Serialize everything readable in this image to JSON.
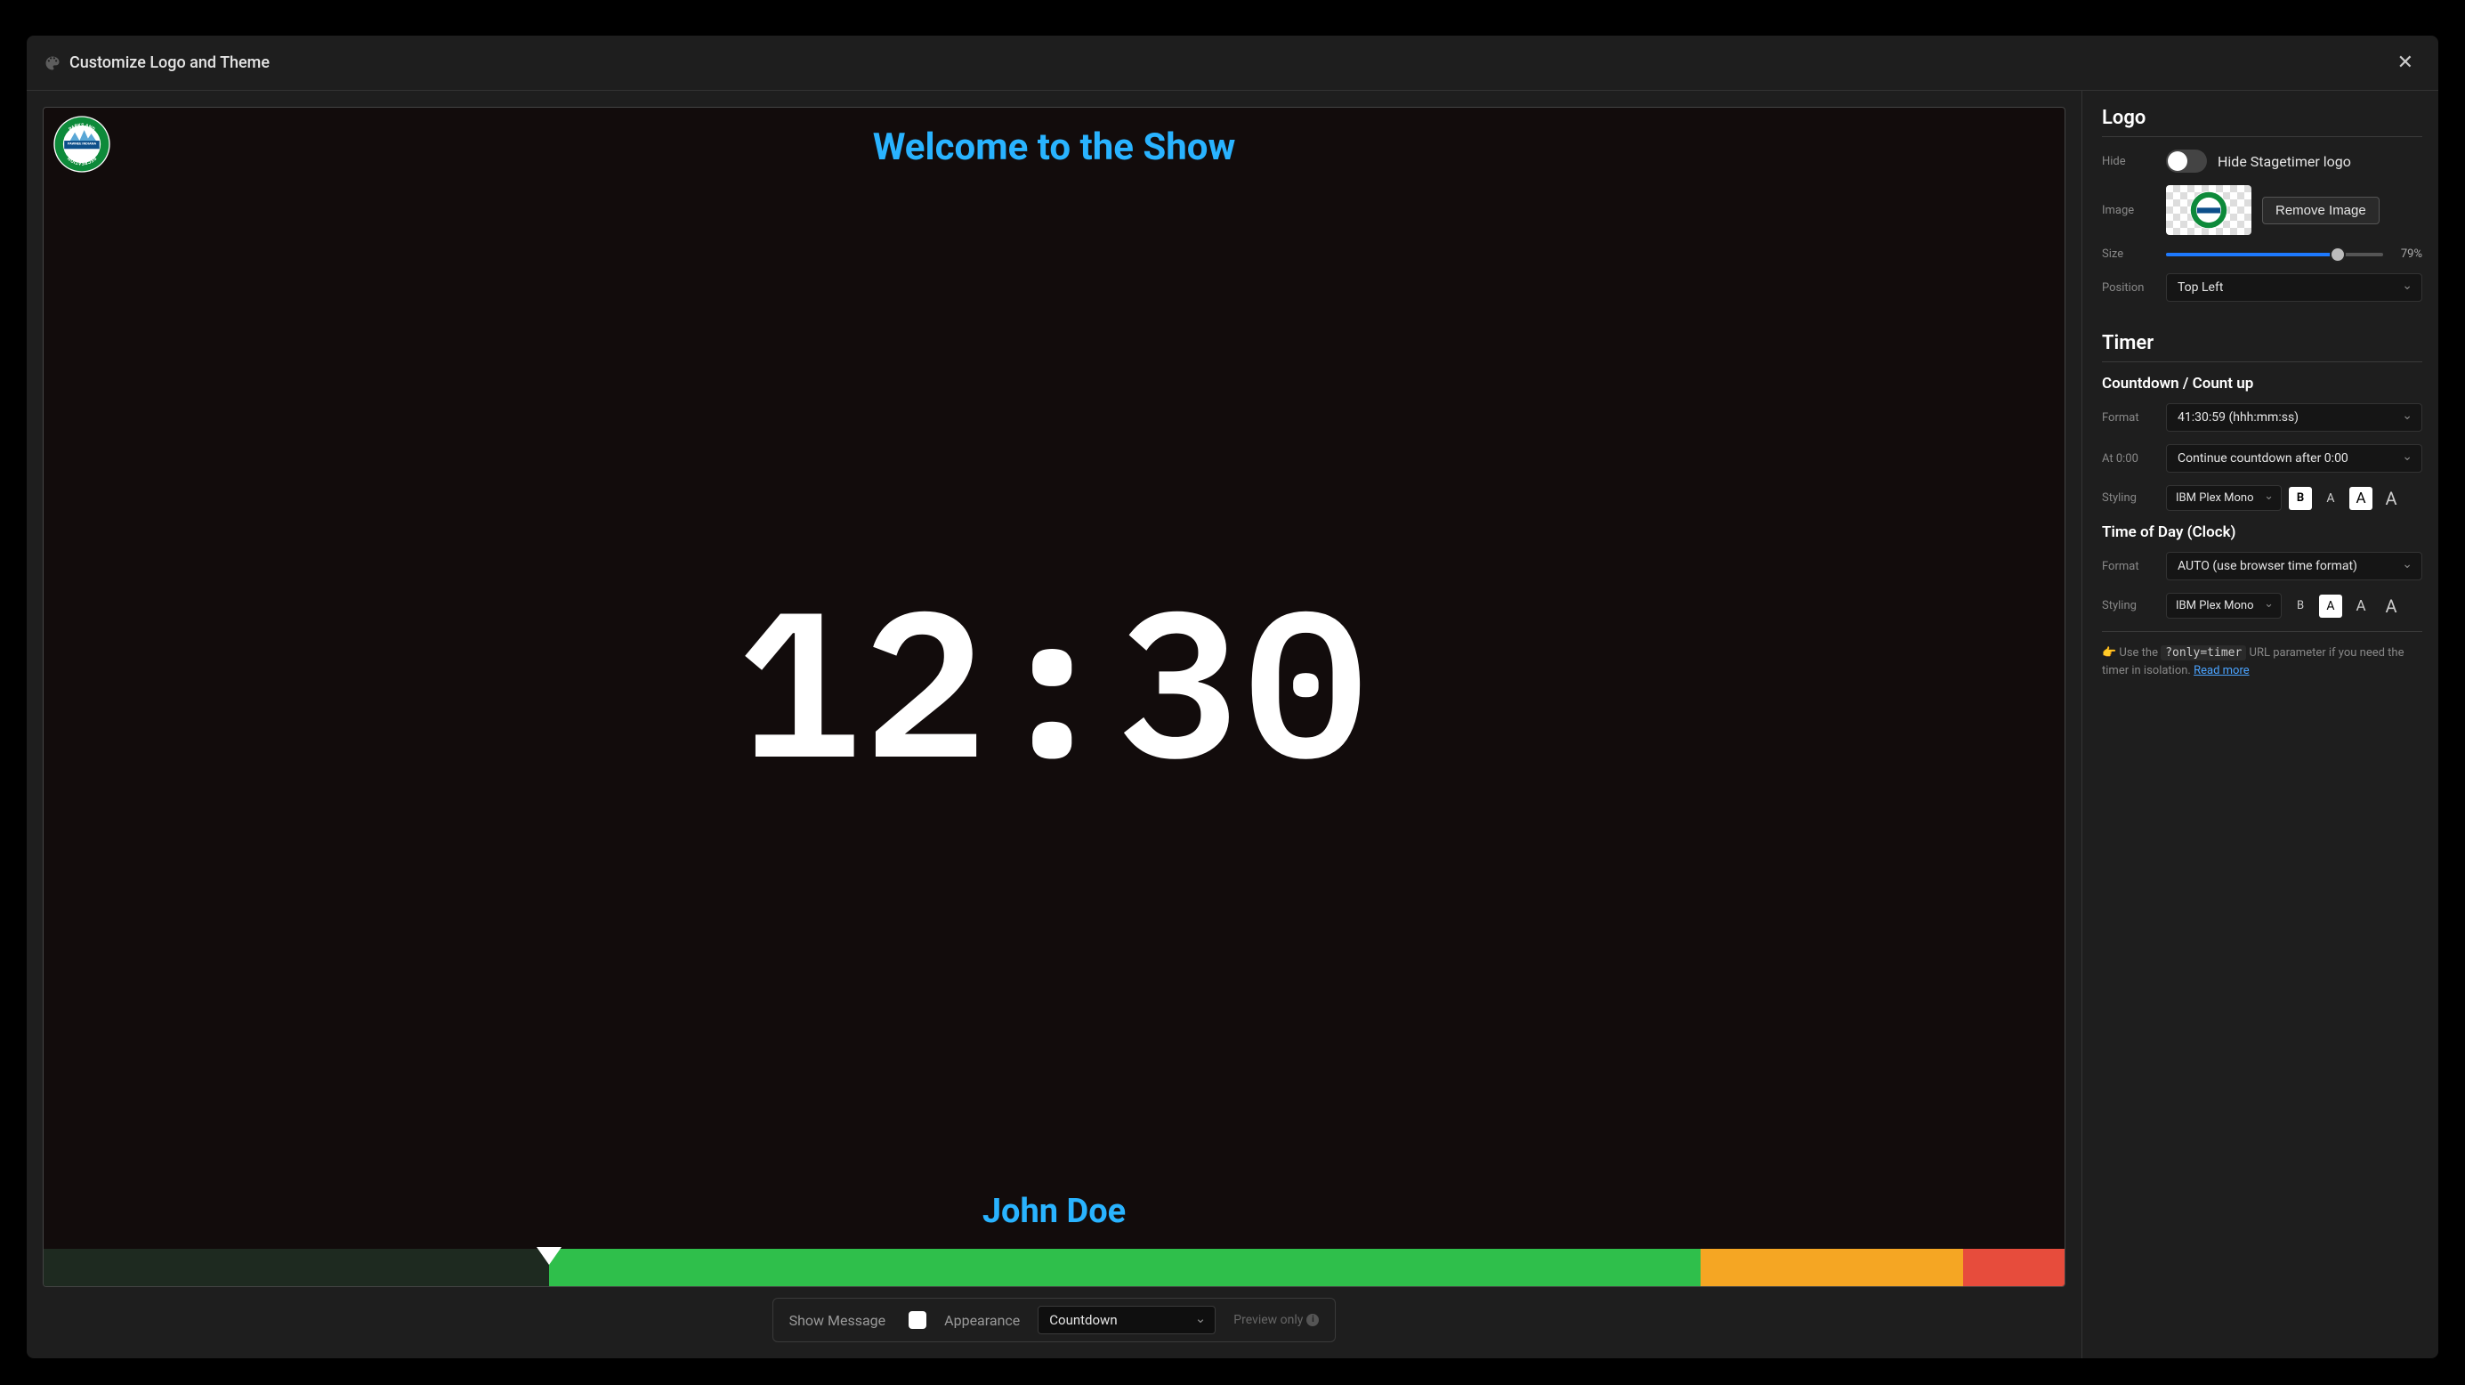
{
  "modal": {
    "title": "Customize Logo and Theme",
    "close_glyph": "✕"
  },
  "preview": {
    "title": "Welcome to the Show",
    "timer_display": "12:30",
    "speaker": "John Doe",
    "progress": {
      "empty_pct": 25,
      "green_pct": 57,
      "orange_pct": 13,
      "red_pct": 5,
      "marker_pct": 25
    },
    "controls": {
      "show_message_label": "Show Message",
      "show_message_checked": false,
      "appearance_label": "Appearance",
      "appearance_value": "Countdown",
      "preview_only_label": "Preview only"
    },
    "logo_badge": {
      "top": "PARKS AND",
      "mid": "PAWNEE INDIANA",
      "bot": "RECREATION"
    }
  },
  "sidebar": {
    "logo": {
      "heading": "Logo",
      "hide_label": "Hide",
      "hide_toggle_text": "Hide Stagetimer logo",
      "hide_toggle_on": false,
      "image_label": "Image",
      "remove_image_btn": "Remove Image",
      "size_label": "Size",
      "size_pct": 79,
      "size_pct_text": "79%",
      "position_label": "Position",
      "position_value": "Top Left"
    },
    "timer": {
      "heading": "Timer",
      "countdown_heading": "Countdown / Count up",
      "format_label": "Format",
      "format_value": "41:30:59 (hhh:mm:ss)",
      "at_zero_label": "At 0:00",
      "at_zero_value": "Continue countdown after 0:00",
      "styling_label": "Styling",
      "font_value": "IBM Plex Mono",
      "bold_btn": "B",
      "size_btns": [
        "A",
        "A",
        "A"
      ],
      "countdown_size_selected_index": 1,
      "clock_heading": "Time of Day (Clock)",
      "clock_format_label": "Format",
      "clock_format_value": "AUTO (use browser time format)",
      "clock_styling_label": "Styling",
      "clock_font_value": "IBM Plex Mono",
      "clock_bold_btn": "B",
      "clock_size_btns": [
        "A",
        "A",
        "A"
      ],
      "clock_size_selected_index": 0
    },
    "hint": {
      "emoji": "👉",
      "text_before": "Use the ",
      "code": "?only=timer",
      "text_after": " URL parameter if you need the timer in isolation. ",
      "link_text": "Read more"
    }
  }
}
